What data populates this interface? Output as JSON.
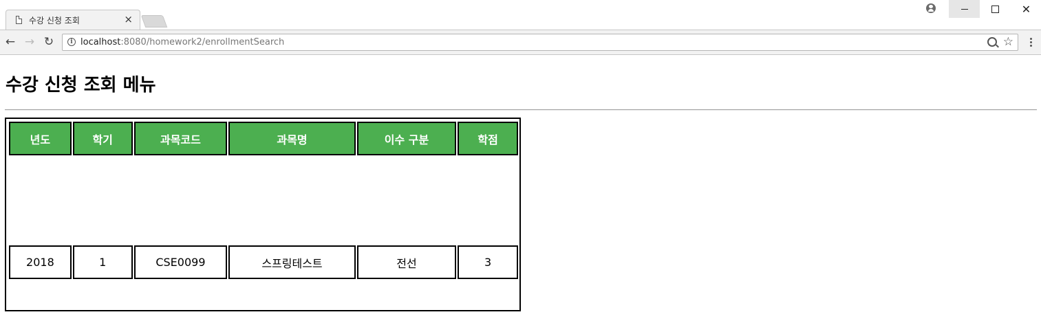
{
  "browser": {
    "tab_title": "수강 신청 조회",
    "tab_close": "×",
    "url_host": "localhost",
    "url_path": ":8080/homework2/enrollmentSearch"
  },
  "page": {
    "title": "수강 신청 조회 메뉴",
    "table": {
      "header_bg": "#4caf50",
      "headers": [
        "년도",
        "학기",
        "과목코드",
        "과목명",
        "이수 구분",
        "학점"
      ],
      "rows": [
        [
          "2018",
          "1",
          "CSE0099",
          "스프링테스트",
          "전선",
          "3"
        ]
      ]
    }
  }
}
